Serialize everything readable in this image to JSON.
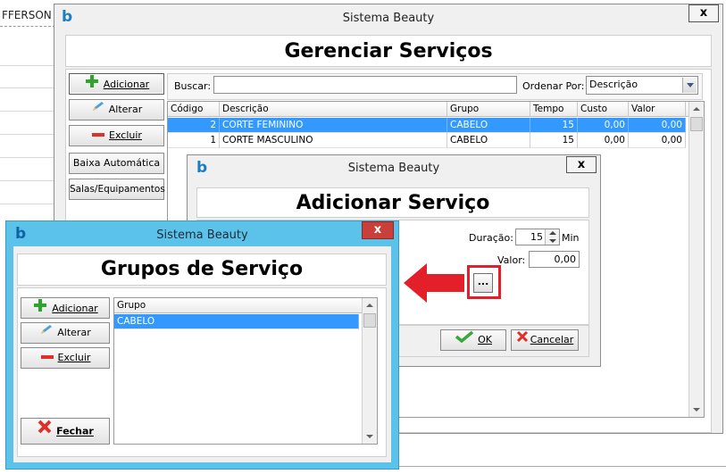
{
  "background": {
    "header_text": "FFERSON"
  },
  "main_window": {
    "title": "Sistema Beauty",
    "close_label": "x",
    "heading": "Gerenciar Serviços",
    "buttons": {
      "add": "Adicionar",
      "edit": "Alterar",
      "delete": "Excluir",
      "auto": "Baixa Automática",
      "rooms": "Salas/Equipamentos"
    },
    "search_label": "Buscar:",
    "search_value": "",
    "order_label": "Ordenar Por:",
    "order_value": "Descrição",
    "table": {
      "columns": [
        "Código",
        "Descrição",
        "Grupo",
        "Tempo",
        "Custo",
        "Valor"
      ],
      "rows": [
        [
          "2",
          "CORTE FEMININO",
          "CABELO",
          "15",
          "0,00",
          "0,00"
        ],
        [
          "1",
          "CORTE MASCULINO",
          "CABELO",
          "15",
          "0,00",
          "0,00"
        ]
      ],
      "selected_row": 0
    }
  },
  "add_window": {
    "title": "Sistema Beauty",
    "close_label": "x",
    "heading": "Adicionar Serviço",
    "duration_label": "Duração:",
    "duration_value": "15",
    "duration_unit": "Min",
    "value_label": "Valor:",
    "value_value": "0,00",
    "ellipsis": "...",
    "ok": "OK",
    "cancel": "Cancelar"
  },
  "groups_window": {
    "title": "Sistema Beauty",
    "close_label": "x",
    "heading": "Grupos de Serviço",
    "buttons": {
      "add": "Adicionar",
      "edit": "Alterar",
      "delete": "Excluir",
      "close": "Fechar"
    },
    "table": {
      "columns": [
        "Grupo"
      ],
      "rows": [
        "CABELO"
      ],
      "selected_row": 0
    }
  },
  "colors": {
    "selection": "#3399ff",
    "annotation_red": "#e3202a",
    "groups_titlebar": "#5bc3ea",
    "logo_blue": "#1a7fc2"
  }
}
